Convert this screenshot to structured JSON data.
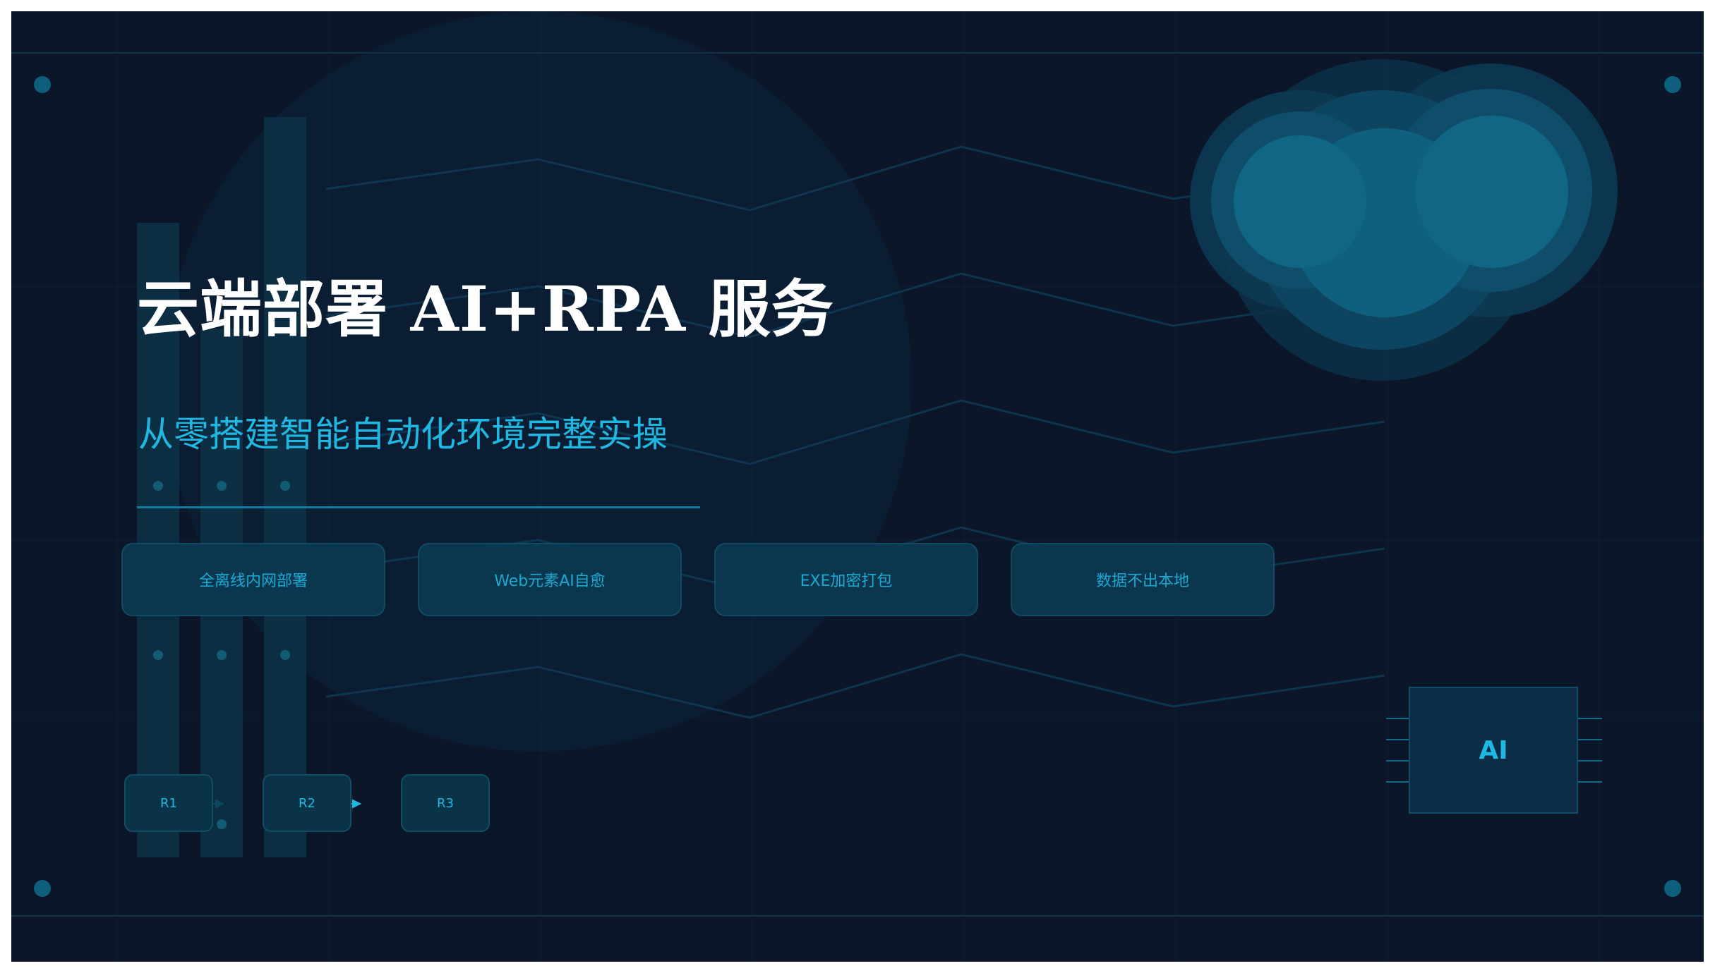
{
  "slide": {
    "title": "云端部署 AI+RPA 服务",
    "subtitle": "从零搭建智能自动化环境完整实操"
  },
  "features": [
    {
      "label": "全离线内网部署"
    },
    {
      "label": "Web元素AI自愈"
    },
    {
      "label": "EXE加密打包"
    },
    {
      "label": "数据不出本地"
    }
  ],
  "robots": [
    {
      "label": "R1"
    },
    {
      "label": "R2"
    },
    {
      "label": "R3"
    }
  ],
  "chip": {
    "label": "AI"
  },
  "colors": {
    "background": "#0b1628",
    "accent": "#1fb8e2",
    "title": "#ffffff",
    "panel": "#0b3a52"
  }
}
